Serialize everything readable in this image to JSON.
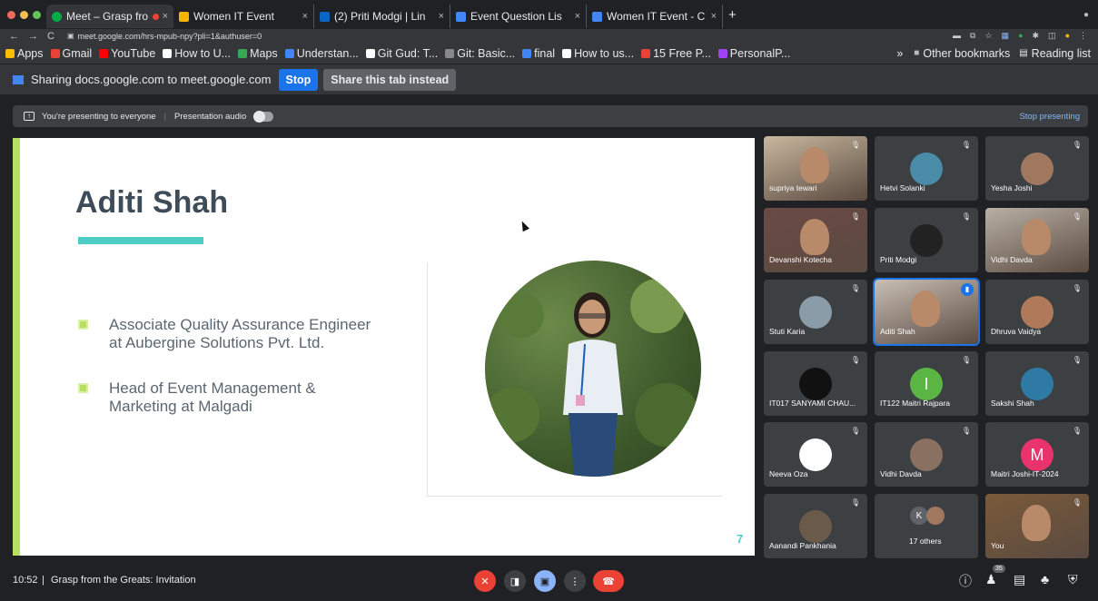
{
  "colors": {
    "accent_blue": "#1a73e8",
    "slide_accent": "#b7e063",
    "teal": "#4ecdc4",
    "end_red": "#ea4335"
  },
  "tabs": [
    {
      "title": "Meet – Grasp fro",
      "icon": "meet-icon"
    },
    {
      "title": "Women IT Event",
      "icon": "slides-icon"
    },
    {
      "title": "(2) Priti Modgi | Lin",
      "icon": "linkedin-icon"
    },
    {
      "title": "Event Question Lis",
      "icon": "docs-icon"
    },
    {
      "title": "Women IT Event - C",
      "icon": "docs-icon"
    }
  ],
  "address": {
    "url": "meet.google.com/hrs-mpub-npy?pli=1&authuser=0"
  },
  "bookmarks": [
    {
      "label": "Apps",
      "icon": "apps-icon",
      "color": "#fbbc04"
    },
    {
      "label": "Gmail",
      "icon": "gmail-icon",
      "color": "#ea4335"
    },
    {
      "label": "YouTube",
      "icon": "youtube-icon",
      "color": "#ff0000"
    },
    {
      "label": "How to U...",
      "icon": "chrome-icon",
      "color": "#ffffff"
    },
    {
      "label": "Maps",
      "icon": "maps-icon",
      "color": "#34a853"
    },
    {
      "label": "Understan...",
      "icon": "s-icon",
      "color": "#4285f4"
    },
    {
      "label": "Git Gud: T...",
      "icon": "chrome-icon",
      "color": "#ffffff"
    },
    {
      "label": "Git: Basic...",
      "icon": "git-icon",
      "color": "#888888"
    },
    {
      "label": "final",
      "icon": "doc-icon",
      "color": "#4285f4"
    },
    {
      "label": "How to us...",
      "icon": "video-icon",
      "color": "#ffffff"
    },
    {
      "label": "15 Free P...",
      "icon": "red-icon",
      "color": "#ea4335"
    },
    {
      "label": "PersonalP...",
      "icon": "purple-icon",
      "color": "#a142f4"
    }
  ],
  "bookmarks_right": {
    "other": "Other bookmarks",
    "reading": "Reading list",
    "more": "»"
  },
  "share_bar": {
    "text": "Sharing docs.google.com to meet.google.com",
    "stop": "Stop",
    "share_tab": "Share this tab instead"
  },
  "present_bar": {
    "presenting": "You're presenting to everyone",
    "audio": "Presentation audio",
    "stop": "Stop presenting"
  },
  "slide": {
    "name": "Aditi Shah",
    "bullets": [
      "Associate Quality Assurance Engineer at Aubergine Solutions Pvt. Ltd.",
      "Head of Event Management & Marketing at Malgadi"
    ],
    "page": "7"
  },
  "participants": [
    {
      "name": "supriya tewari",
      "kind": "video",
      "bg": "#c8b89e"
    },
    {
      "name": "Hetvi Solanki",
      "kind": "avatar",
      "bg": "#4a8ba8"
    },
    {
      "name": "Yesha Joshi",
      "kind": "avatar",
      "bg": "#a07860"
    },
    {
      "name": "Devanshi Kotecha",
      "kind": "video",
      "bg": "#6a4a44"
    },
    {
      "name": "Priti Modgi",
      "kind": "avatar",
      "bg": "#222222"
    },
    {
      "name": "Vidhi Davda",
      "kind": "video",
      "bg": "#b9b0a4"
    },
    {
      "name": "Stuti Karia",
      "kind": "avatar",
      "bg": "#8a9ca8"
    },
    {
      "name": "Aditi Shah",
      "kind": "video",
      "bg": "#c9bfb5"
    },
    {
      "name": "Dhruva Vaidya",
      "kind": "avatar",
      "bg": "#b07a5a"
    },
    {
      "name": "IT017 SANYAMI CHAU...",
      "kind": "avatar",
      "bg": "#111111"
    },
    {
      "name": "IT122 Maitri Rajpara",
      "kind": "letter",
      "bg": "#5bb543",
      "letter": "I"
    },
    {
      "name": "Sakshi Shah",
      "kind": "avatar",
      "bg": "#2e7aa5"
    },
    {
      "name": "Neeva Oza",
      "kind": "avatar",
      "bg": "#ffffff"
    },
    {
      "name": "Vidhi Davda",
      "kind": "avatar",
      "bg": "#8a7060"
    },
    {
      "name": "Maitri Joshi-IT-2024",
      "kind": "letter",
      "bg": "#e8336d",
      "letter": "M"
    },
    {
      "name": "Aanandi Pankhania",
      "kind": "avatar",
      "bg": "#6a5a4a"
    },
    {
      "name": "17 others",
      "kind": "others",
      "bg": "#3c4043"
    },
    {
      "name": "You",
      "kind": "video",
      "bg": "#7a5a3a"
    }
  ],
  "others_letter": "K",
  "bottom": {
    "time": "10:52",
    "separator": "|",
    "meeting": "Grasp from the Greats: Invitation",
    "people_count": "35"
  }
}
